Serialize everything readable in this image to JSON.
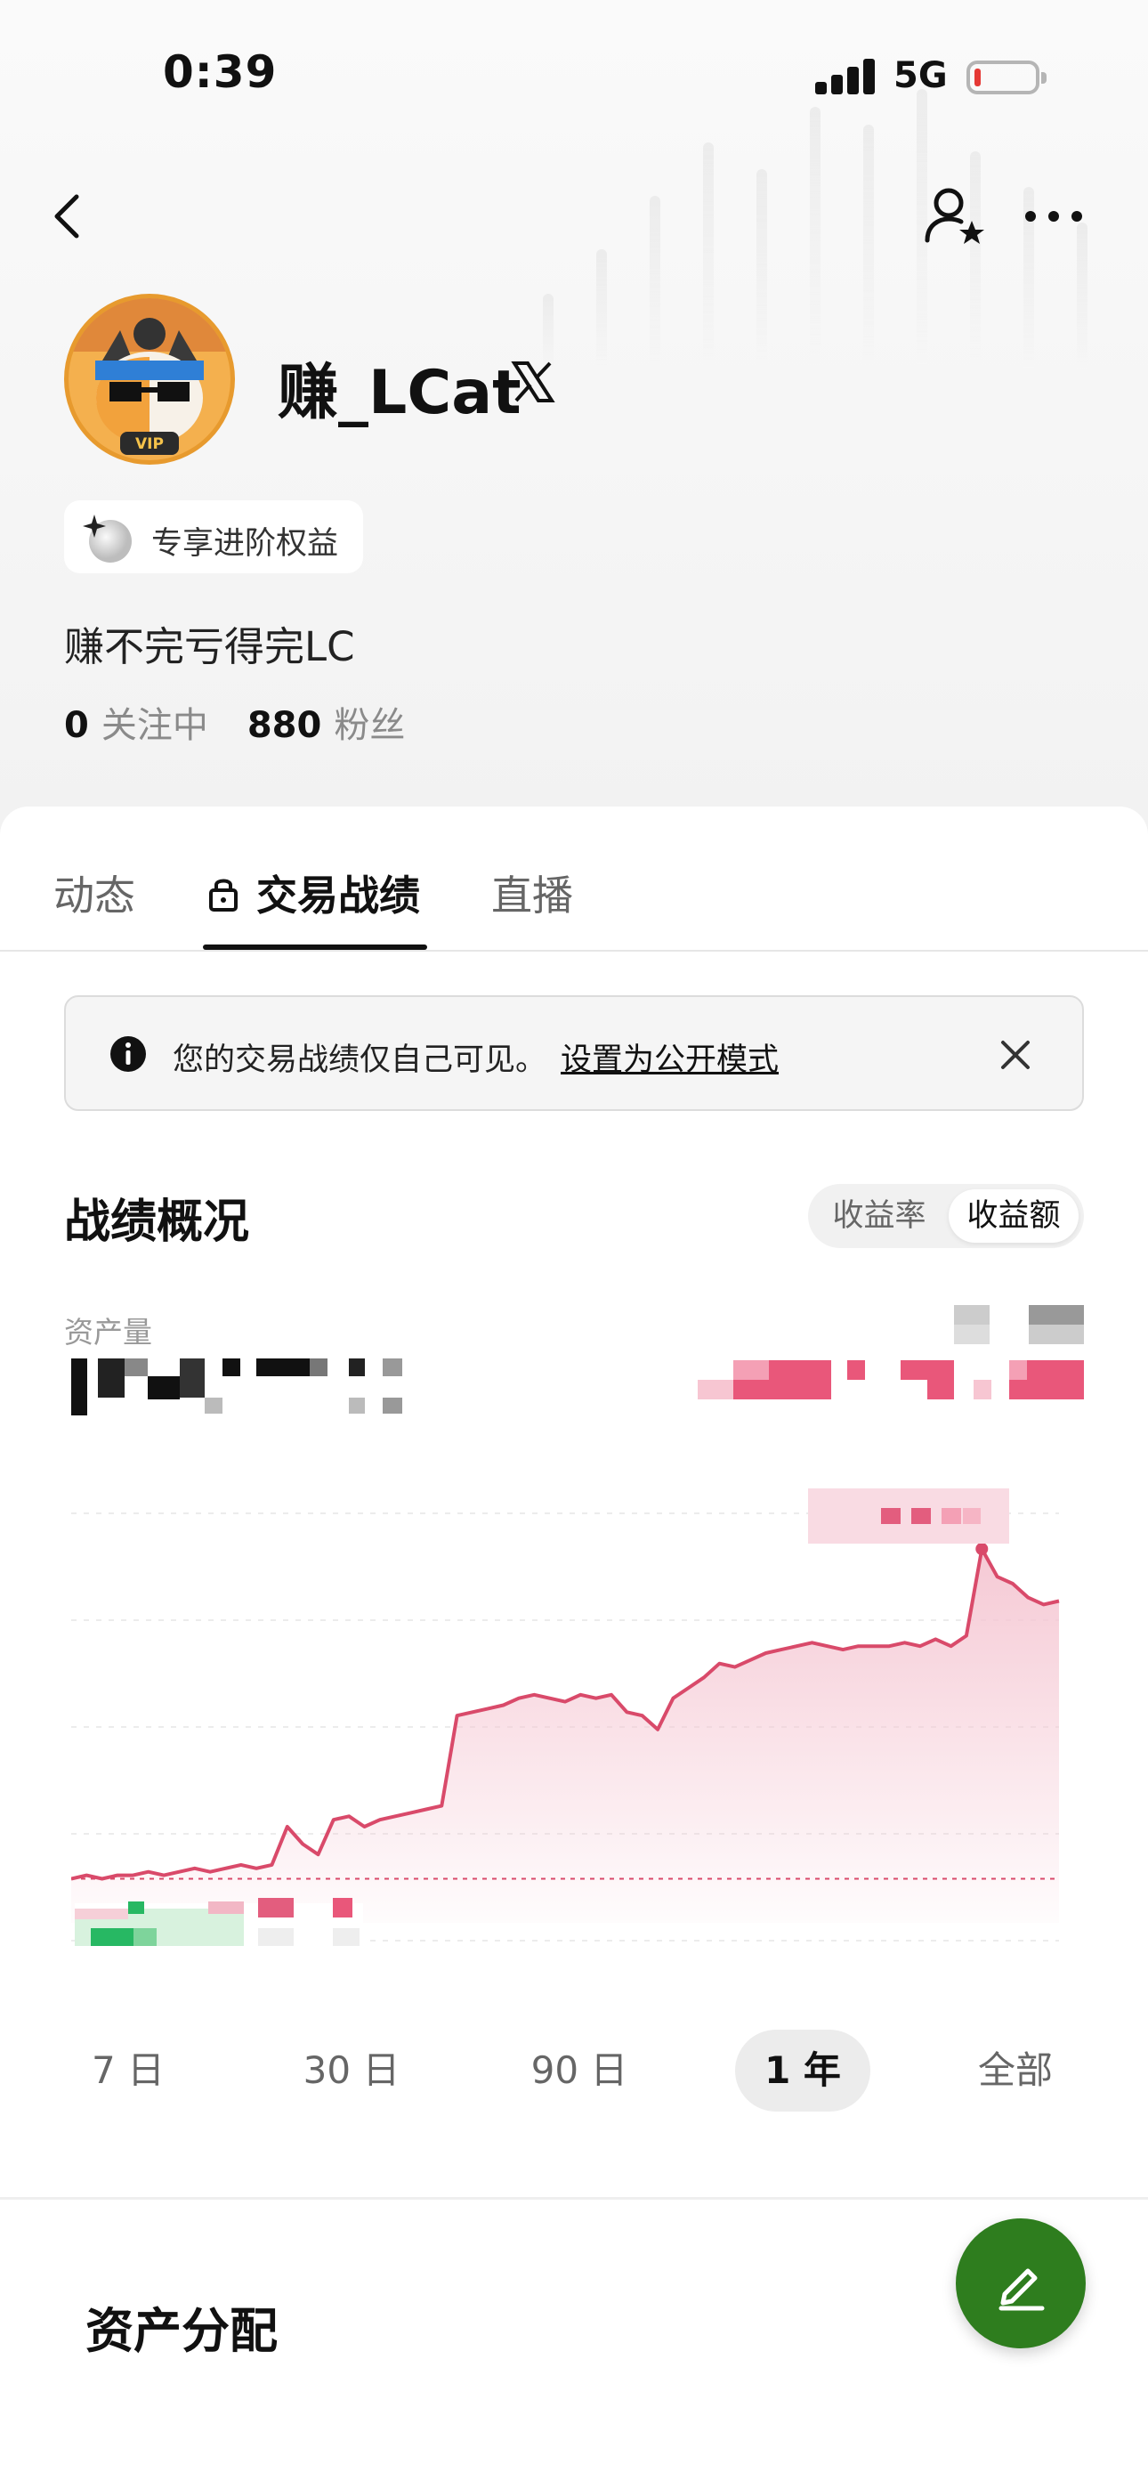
{
  "status_bar": {
    "time": "0:39",
    "network": "5G",
    "battery_level": 0.1,
    "battery_color": "#e53935"
  },
  "nav": {
    "back": "back-icon",
    "follow": "follow-user-icon",
    "more": "more-icon"
  },
  "profile": {
    "username": "赚_LCat",
    "badge": "VIP",
    "perk_label": "专享进阶权益",
    "bio": "赚不完亏得完LC",
    "following_count": "0",
    "following_label": "关注中",
    "followers_count": "880",
    "followers_label": "粉丝"
  },
  "tabs": [
    {
      "label": "动态",
      "active": false
    },
    {
      "label": "交易战绩",
      "active": true
    },
    {
      "label": "直播",
      "active": false
    }
  ],
  "notice": {
    "text": "您的交易战绩仅自己可见。",
    "link": "设置为公开模式"
  },
  "overview": {
    "title": "战绩概况",
    "toggle": [
      {
        "label": "收益率",
        "active": false
      },
      {
        "label": "收益额",
        "active": true
      }
    ],
    "asset_label": "资产量"
  },
  "chart_data": {
    "type": "area",
    "line_color": "#d94a6a",
    "fill_color": "#f5c6d2",
    "baseline_color": "#d94a6a",
    "values": [
      0.05,
      0.06,
      0.05,
      0.06,
      0.06,
      0.07,
      0.06,
      0.07,
      0.08,
      0.07,
      0.08,
      0.09,
      0.08,
      0.09,
      0.2,
      0.15,
      0.12,
      0.22,
      0.23,
      0.2,
      0.22,
      0.23,
      0.24,
      0.25,
      0.26,
      0.52,
      0.53,
      0.54,
      0.55,
      0.57,
      0.58,
      0.57,
      0.56,
      0.58,
      0.57,
      0.58,
      0.53,
      0.52,
      0.48,
      0.57,
      0.6,
      0.63,
      0.67,
      0.66,
      0.68,
      0.7,
      0.71,
      0.72,
      0.73,
      0.72,
      0.71,
      0.72,
      0.72,
      0.72,
      0.73,
      0.72,
      0.74,
      0.72,
      0.75,
      1.0,
      0.92,
      0.9,
      0.86,
      0.84,
      0.85
    ]
  },
  "ranges": [
    {
      "label": "7 日",
      "active": false
    },
    {
      "label": "30 日",
      "active": false
    },
    {
      "label": "90 日",
      "active": false
    },
    {
      "label": "1 年",
      "active": true
    },
    {
      "label": "全部",
      "active": false
    }
  ],
  "allocation": {
    "title": "资产分配"
  },
  "fab": {
    "icon": "edit-icon",
    "color": "#2e7d1e"
  }
}
